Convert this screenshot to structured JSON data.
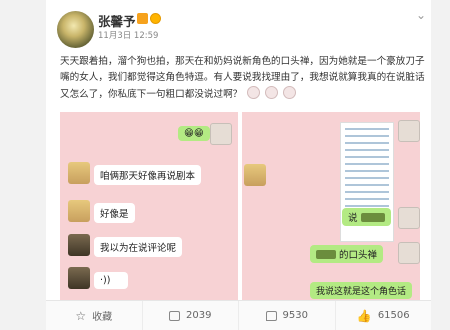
{
  "post": {
    "username": "张馨予",
    "timestamp": "11月3日 12:59",
    "text": "天天跟着拍，溜个狗也拍，那天在和奶妈说新角色的口头禅，因为她就是一个豪放刀子嘴的女人，我们都觉得这角色特逗。有人要说我找理由了，我想说就算我真的在说脏话又怎么了，你私底下一句粗口都没说过啊？"
  },
  "left_chat": {
    "messages": [
      "咱俩那天好像再说剧本",
      "好像是",
      "我以为在说评论呢"
    ]
  },
  "right_chat": {
    "messages": [
      "说",
      "的口头禅",
      "我说这就是这个角色话"
    ]
  },
  "actions": {
    "favorite": "收藏",
    "repost": "2039",
    "comment": "9530",
    "like": "61506"
  }
}
